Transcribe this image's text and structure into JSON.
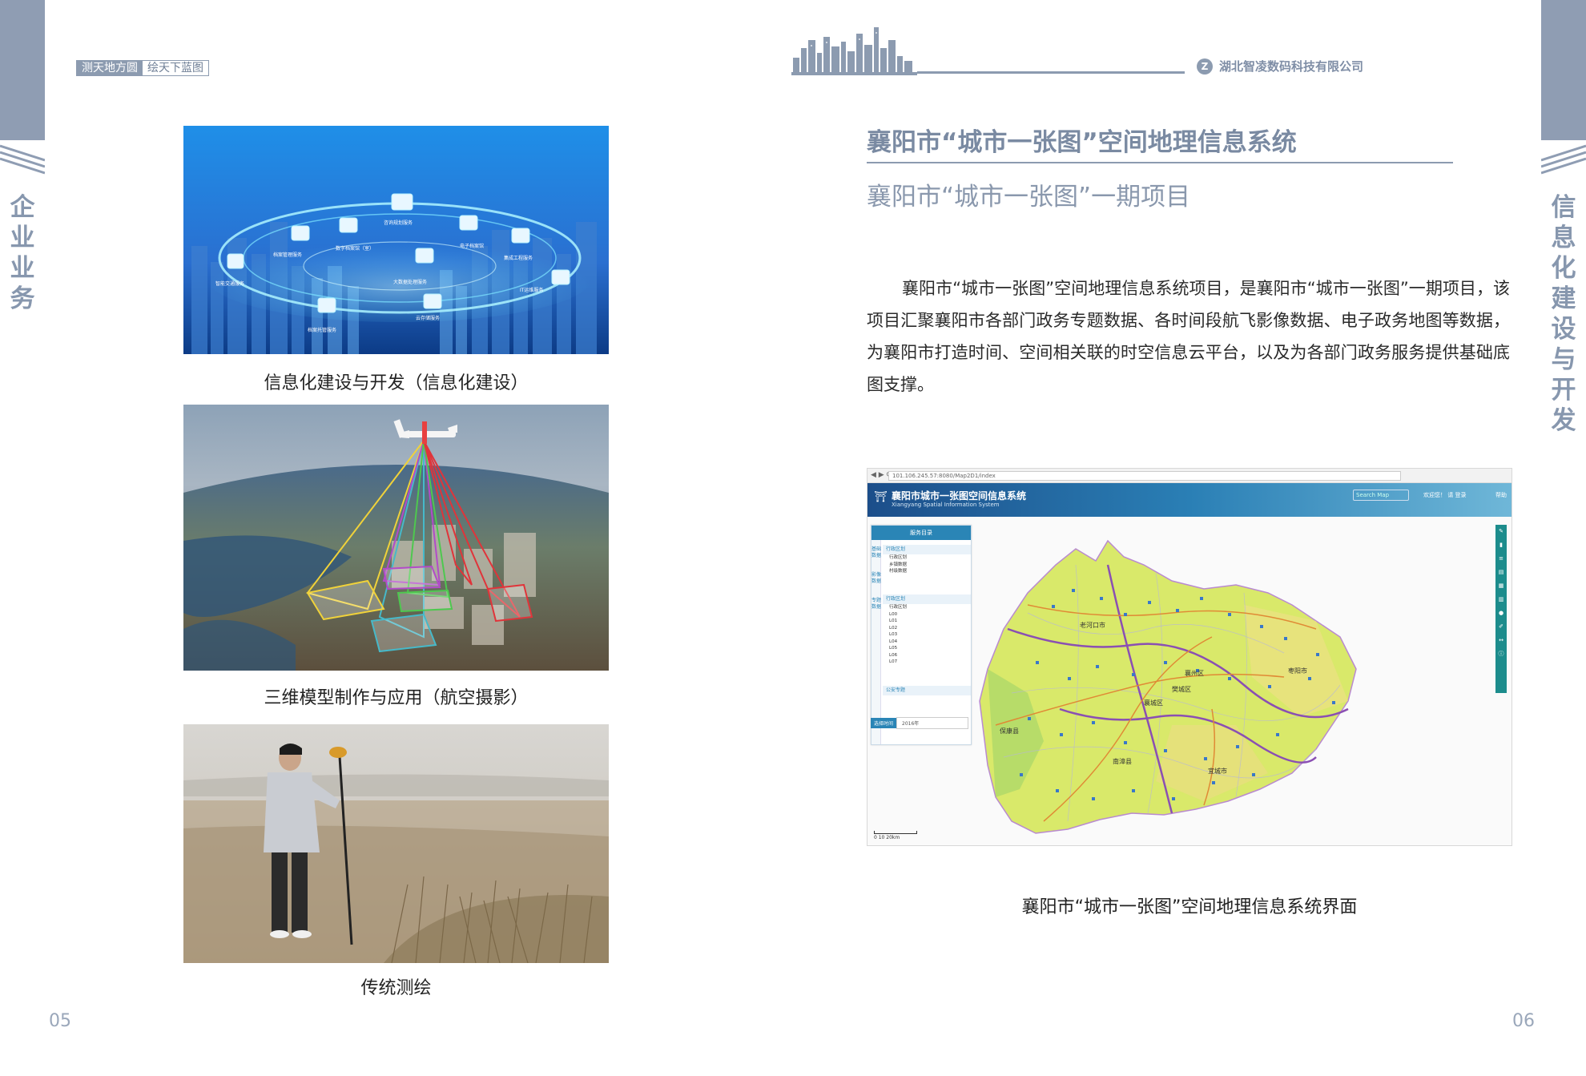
{
  "left_page": {
    "slogan_part1": "测天地方圆",
    "slogan_part2": "绘天下蓝图",
    "side_label": "企业业务",
    "page_number": "05",
    "photo1": {
      "caption": "信息化建设与开发（信息化建设）",
      "service_labels": [
        "智能交通服务",
        "档案管理服务",
        "数字档案馆（室）",
        "咨询规划服务",
        "档案托管服务",
        "大数据处理服务",
        "电子档案馆",
        "集成工程服务",
        "IT运维服务",
        "云存储服务"
      ]
    },
    "photo2": {
      "caption": "三维模型制作与应用（航空摄影）"
    },
    "photo3": {
      "caption": "传统测绘"
    }
  },
  "right_page": {
    "company_logo": "Z",
    "company_name": "湖北智凌数码科技有限公司",
    "title": "襄阳市“城市一张图”空间地理信息系统",
    "subtitle": "襄阳市“城市一张图”一期项目",
    "body": "襄阳市“城市一张图”空间地理信息系统项目，是襄阳市“城市一张图”一期项目，该项目汇聚襄阳市各部门政务专题数据、各时间段航飞影像数据、电子政务地图等数据，为襄阳市打造时间、空间相关联的时空信息云平台，以及为各部门政务服务提供基础底图支撑。",
    "side_label": "信息化建设与开发",
    "page_number": "06",
    "screenshot": {
      "url": "101.106.245.57:8080/Map2D1/index",
      "app_title": "襄阳市城市一张图空间信息系统",
      "app_subtitle": "Xiangyang Spatial Information System",
      "search_placeholder": "Search Map",
      "user_text": "欢迎您！ 请 登录",
      "help_text": "帮助",
      "panel_title": "服务目录",
      "panel_tabs": [
        "基础数据",
        "影像数据",
        "专题数据"
      ],
      "group1": {
        "header": "行政区划",
        "items": [
          "行政区划",
          "乡镇数据",
          "村级数据"
        ]
      },
      "group2": {
        "header": "行政区划",
        "items": [
          "行政区划",
          "L00",
          "L01",
          "L02",
          "L03",
          "L04",
          "L05",
          "L06",
          "L07"
        ]
      },
      "group3": {
        "header": "公安专题",
        "items": []
      },
      "footer_label": "选择时间",
      "footer_value": "2016年",
      "scale_text": "0     10      20km",
      "toolbar_icons": [
        "wrench-icon",
        "bookmark-icon",
        "layers-icon",
        "print-icon",
        "grid-icon",
        "table-icon",
        "pin-icon",
        "pencil-icon",
        "measure-icon",
        "info-icon"
      ],
      "place_labels": [
        "老河口市",
        "樊城区",
        "襄州区",
        "枣阳市",
        "襄城区",
        "保康县",
        "南漳县",
        "宜城市"
      ]
    },
    "screenshot_caption": "襄阳市“城市一张图”空间地理信息系统界面"
  },
  "colors": {
    "accent": "#8c9bb0",
    "accent_text": "#7a8aa2",
    "map_land": "#d9e96a",
    "map_road_main": "#8a4fb3",
    "map_road_secondary": "#e08a35"
  }
}
